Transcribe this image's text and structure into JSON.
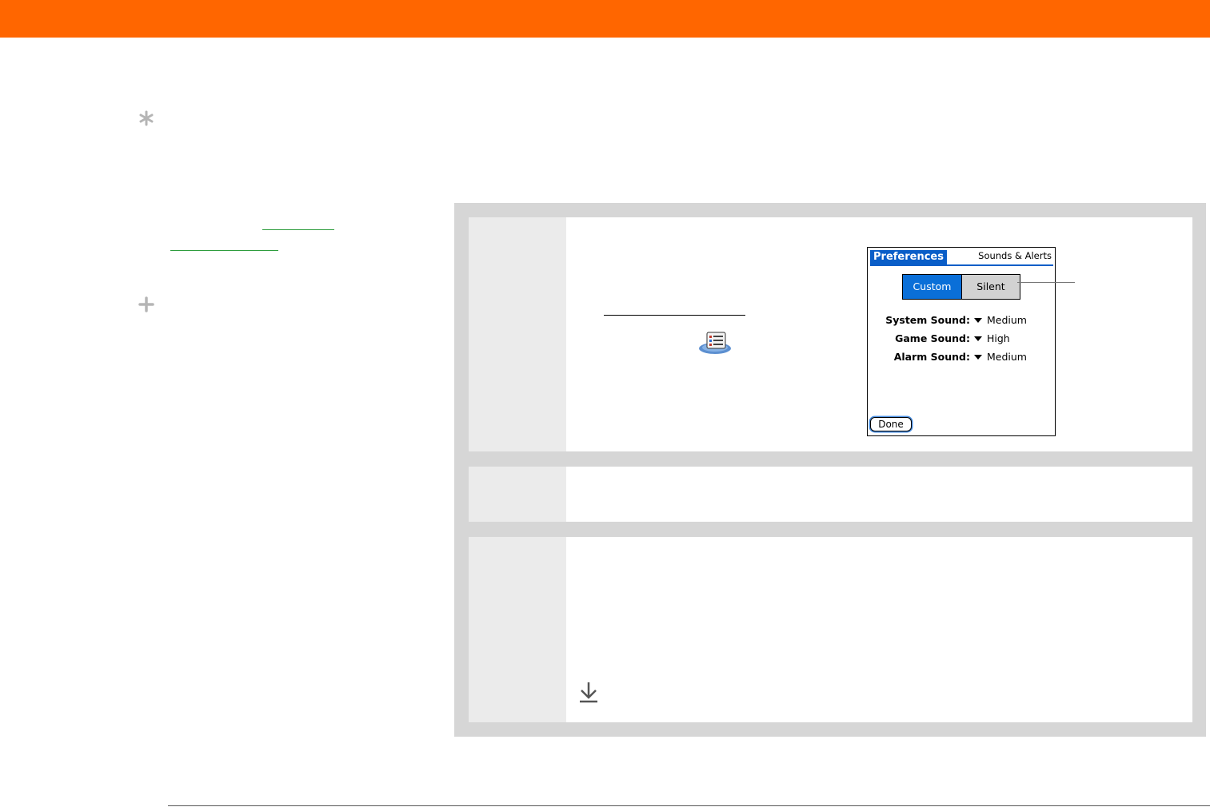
{
  "colors": {
    "header": "#ff6600",
    "panel": "#d6d6d6",
    "step_number_cell": "#ebebeb",
    "link": "#2e9d3e",
    "palm_accent": "#0a5ec8"
  },
  "sidebar": {
    "icons": [
      "asterisk-icon",
      "plus-icon"
    ]
  },
  "prefs_screen": {
    "tab_title": "Preferences",
    "category": "Sounds & Alerts",
    "segments": {
      "custom": "Custom",
      "silent": "Silent",
      "selected": "Custom"
    },
    "sounds": [
      {
        "label": "System Sound:",
        "value": "Medium"
      },
      {
        "label": "Game Sound:",
        "value": "High"
      },
      {
        "label": "Alarm Sound:",
        "value": "Medium"
      }
    ],
    "done_button": "Done"
  },
  "icons": {
    "prefs_app": "preferences-app-icon",
    "download": "download-arrow-icon"
  }
}
